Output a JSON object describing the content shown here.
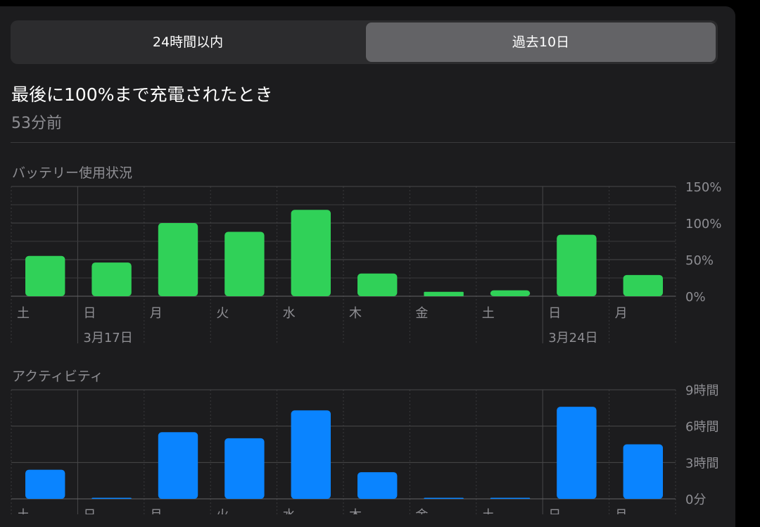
{
  "tabs": [
    {
      "label": "24時間以内",
      "selected": false
    },
    {
      "label": "過去10日",
      "selected": true
    }
  ],
  "last_full_charge": {
    "title": "最後に100%まで充電されたとき",
    "time": "53分前"
  },
  "colors": {
    "battery_bar": "#30d158",
    "activity_bar": "#0a84ff",
    "background": "#1c1c1e",
    "selected_tab": "#636366"
  },
  "day_labels": [
    "土",
    "日",
    "月",
    "火",
    "水",
    "木",
    "金",
    "土",
    "日",
    "月"
  ],
  "date_labels": [
    {
      "index": 1,
      "text": "3月17日"
    },
    {
      "index": 8,
      "text": "3月24日"
    }
  ],
  "chart_data": [
    {
      "type": "bar",
      "title": "バッテリー使用状況",
      "categories": [
        "土",
        "日",
        "月",
        "火",
        "水",
        "木",
        "金",
        "土",
        "日",
        "月"
      ],
      "values": [
        55,
        46,
        100,
        88,
        118,
        31,
        6,
        8,
        84,
        29
      ],
      "ylim": [
        0,
        150
      ],
      "yticks": [
        "0%",
        "50%",
        "100%",
        "150%"
      ],
      "unit": "%",
      "grid": true
    },
    {
      "type": "bar",
      "title": "アクティビティ",
      "categories": [
        "土",
        "日",
        "月",
        "火",
        "水",
        "木",
        "金",
        "土",
        "日",
        "月"
      ],
      "values": [
        2.4,
        0,
        5.5,
        5.0,
        7.3,
        2.2,
        0.05,
        0.05,
        7.6,
        4.5
      ],
      "ylim": [
        0,
        9
      ],
      "yticks": [
        "0分",
        "3時間",
        "6時間",
        "9時間"
      ],
      "unit": "時間",
      "grid": true
    }
  ]
}
